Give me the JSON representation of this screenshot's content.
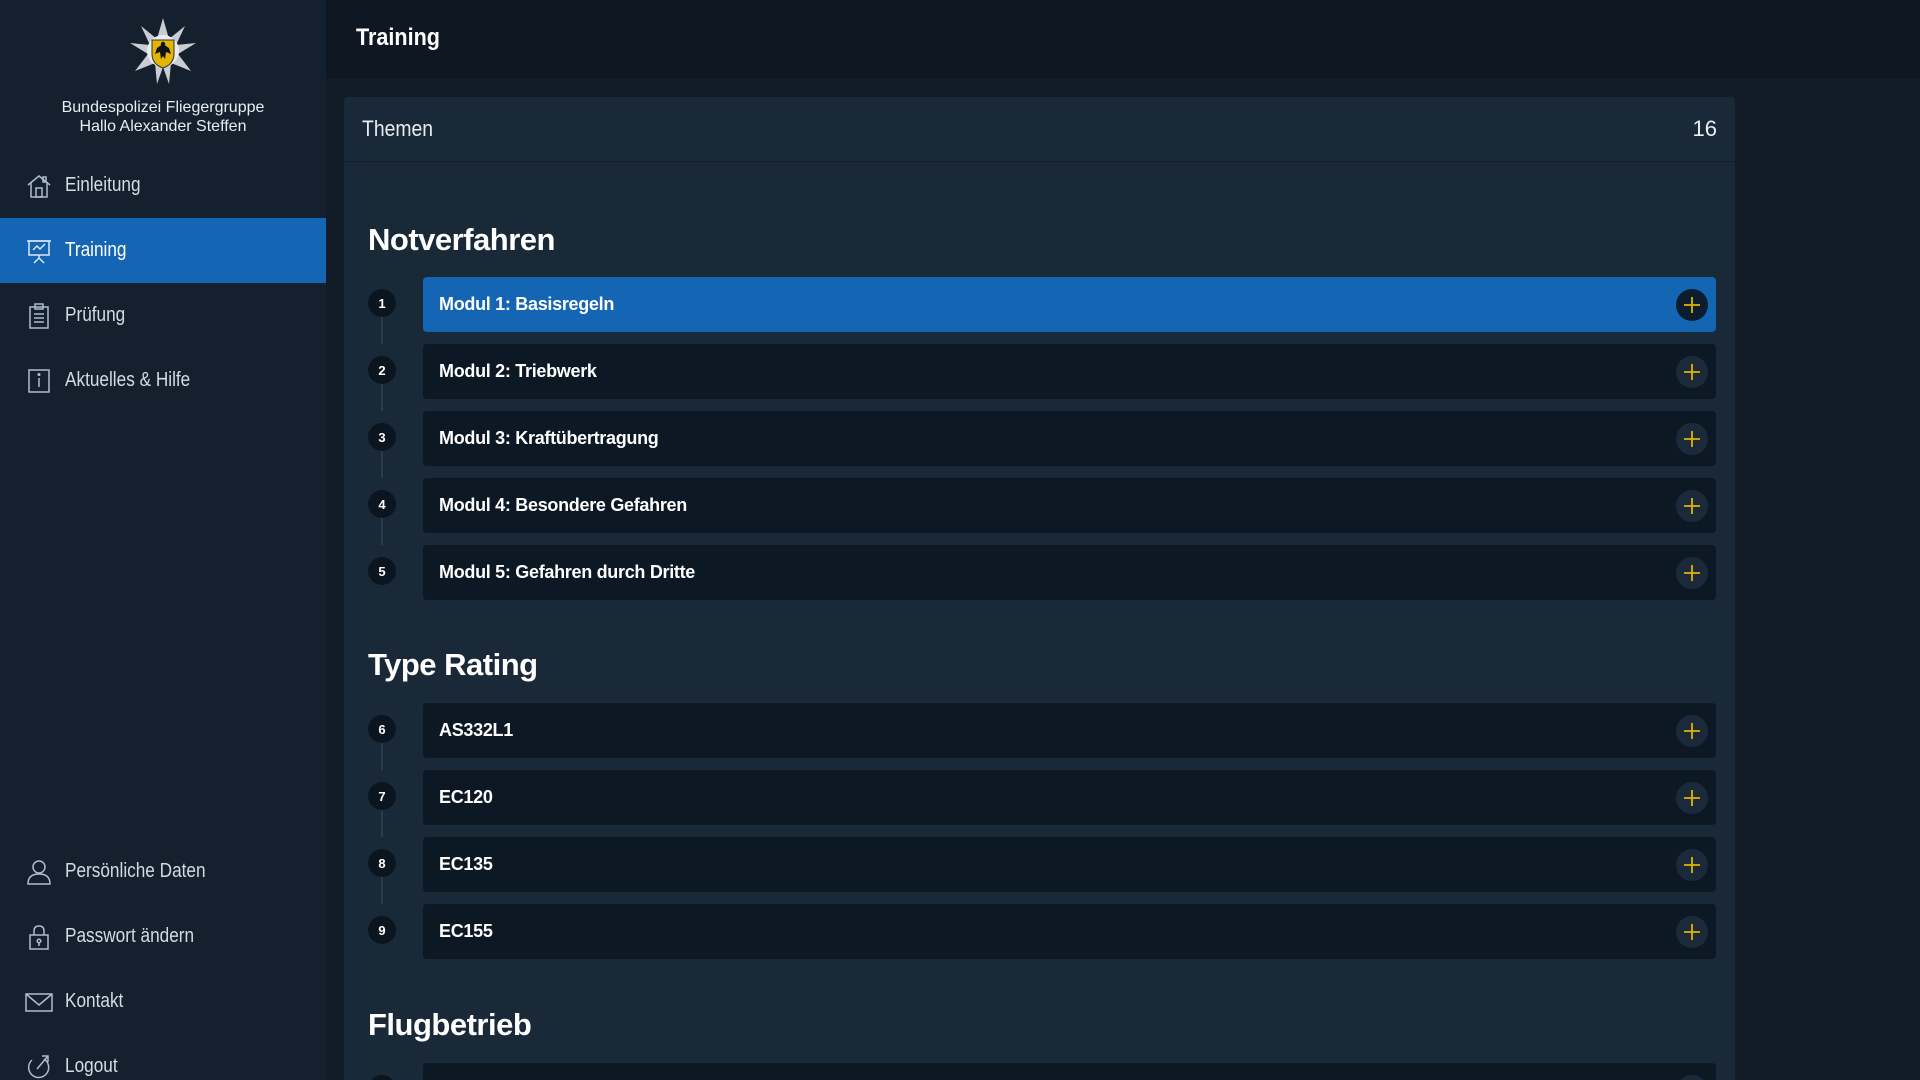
{
  "sidebar": {
    "org_name": "Bundespolizei Fliegergruppe",
    "greeting": "Hallo Alexander Steffen",
    "nav_top": [
      {
        "label": "Einleitung",
        "icon": "home-icon"
      },
      {
        "label": "Training",
        "icon": "presentation-icon",
        "active": true
      },
      {
        "label": "Prüfung",
        "icon": "clipboard-icon"
      },
      {
        "label": "Aktuelles & Hilfe",
        "icon": "info-icon"
      }
    ],
    "nav_bottom": [
      {
        "label": "Persönliche Daten",
        "icon": "user-icon"
      },
      {
        "label": "Passwort ändern",
        "icon": "lock-icon"
      },
      {
        "label": "Kontakt",
        "icon": "mail-icon"
      },
      {
        "label": "Logout",
        "icon": "logout-icon"
      }
    ]
  },
  "header": {
    "title": "Training"
  },
  "panel": {
    "title": "Themen",
    "count": "16"
  },
  "sections": [
    {
      "title": "Notverfahren",
      "items": [
        {
          "num": "1",
          "label": "Modul 1: Basisregeln",
          "active": true
        },
        {
          "num": "2",
          "label": "Modul 2: Triebwerk"
        },
        {
          "num": "3",
          "label": "Modul 3: Kraftübertragung"
        },
        {
          "num": "4",
          "label": "Modul 4: Besondere Gefahren"
        },
        {
          "num": "5",
          "label": "Modul 5: Gefahren durch Dritte"
        }
      ]
    },
    {
      "title": "Type Rating",
      "items": [
        {
          "num": "6",
          "label": "AS332L1"
        },
        {
          "num": "7",
          "label": "EC120"
        },
        {
          "num": "8",
          "label": "EC135"
        },
        {
          "num": "9",
          "label": "EC155"
        }
      ]
    },
    {
      "title": "Flugbetrieb",
      "items": []
    }
  ],
  "colors": {
    "accent": "#1565b5",
    "plus_icon": "#e0b400",
    "sidebar_bg": "#14202d",
    "panel_bg": "#192938"
  }
}
